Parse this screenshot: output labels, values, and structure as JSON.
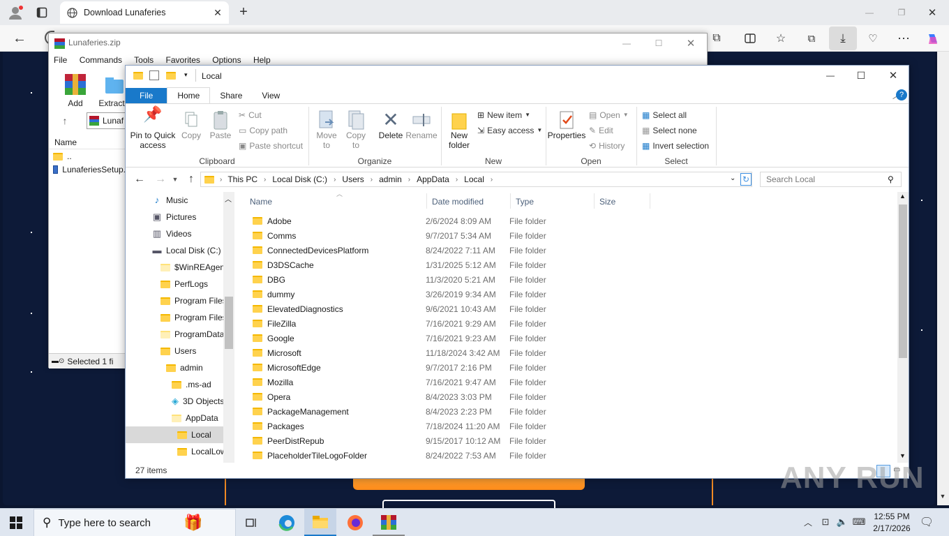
{
  "browser": {
    "tab_title": "Download Lunaferies",
    "new_tab_icon": "plus-icon"
  },
  "winrar": {
    "title": "Lunaferies.zip",
    "menu": [
      "File",
      "Commands",
      "Tools",
      "Favorites",
      "Options",
      "Help"
    ],
    "toolbar": {
      "add": "Add",
      "extract": "Extract"
    },
    "path": "Lunaf",
    "name_header": "Name",
    "files": [
      "..",
      "LunaferiesSetup."
    ],
    "status": "Selected 1 fi"
  },
  "explorer": {
    "title": "Local",
    "ribbon_tabs": [
      "File",
      "Home",
      "Share",
      "View"
    ],
    "clipboard": {
      "pin": "Pin to Quick access",
      "copy": "Copy",
      "paste": "Paste",
      "cut": "Cut",
      "copy_path": "Copy path",
      "paste_shortcut": "Paste shortcut",
      "label": "Clipboard"
    },
    "organize": {
      "move_to": "Move to",
      "copy_to": "Copy to",
      "delete": "Delete",
      "rename": "Rename",
      "label": "Organize"
    },
    "new": {
      "new_folder": "New folder",
      "new_item": "New item",
      "easy_access": "Easy access",
      "label": "New"
    },
    "open": {
      "properties": "Properties",
      "open": "Open",
      "edit": "Edit",
      "history": "History",
      "label": "Open"
    },
    "select": {
      "select_all": "Select all",
      "select_none": "Select none",
      "invert": "Invert selection",
      "label": "Select"
    },
    "breadcrumb": [
      "This PC",
      "Local Disk (C:)",
      "Users",
      "admin",
      "AppData",
      "Local"
    ],
    "search_placeholder": "Search Local",
    "tree": [
      {
        "label": "Music",
        "icon": "music-icon"
      },
      {
        "label": "Pictures",
        "icon": "pictures-icon"
      },
      {
        "label": "Videos",
        "icon": "videos-icon"
      },
      {
        "label": "Local Disk (C:)",
        "icon": "drive-icon"
      },
      {
        "label": "$WinREAgent",
        "icon": "folder-icon"
      },
      {
        "label": "PerfLogs",
        "icon": "folder-icon"
      },
      {
        "label": "Program Files",
        "icon": "folder-icon"
      },
      {
        "label": "Program Files",
        "icon": "folder-icon"
      },
      {
        "label": "ProgramData",
        "icon": "folder-icon"
      },
      {
        "label": "Users",
        "icon": "folder-icon"
      },
      {
        "label": "admin",
        "icon": "folder-icon"
      },
      {
        "label": ".ms-ad",
        "icon": "folder-icon"
      },
      {
        "label": "3D Objects",
        "icon": "3d-objects-icon"
      },
      {
        "label": "AppData",
        "icon": "folder-icon"
      },
      {
        "label": "Local",
        "icon": "folder-icon"
      },
      {
        "label": "LocalLow",
        "icon": "folder-icon"
      }
    ],
    "columns": [
      "Name",
      "Date modified",
      "Type",
      "Size"
    ],
    "rows": [
      {
        "name": "Adobe",
        "date": "2/6/2024 8:09 AM",
        "type": "File folder"
      },
      {
        "name": "Comms",
        "date": "9/7/2017 5:34 AM",
        "type": "File folder"
      },
      {
        "name": "ConnectedDevicesPlatform",
        "date": "8/24/2022 7:11 AM",
        "type": "File folder"
      },
      {
        "name": "D3DSCache",
        "date": "1/31/2025 5:12 AM",
        "type": "File folder"
      },
      {
        "name": "DBG",
        "date": "11/3/2020 5:21 AM",
        "type": "File folder"
      },
      {
        "name": "dummy",
        "date": "3/26/2019 9:34 AM",
        "type": "File folder"
      },
      {
        "name": "ElevatedDiagnostics",
        "date": "9/6/2021 10:43 AM",
        "type": "File folder"
      },
      {
        "name": "FileZilla",
        "date": "7/16/2021 9:29 AM",
        "type": "File folder"
      },
      {
        "name": "Google",
        "date": "7/16/2021 9:23 AM",
        "type": "File folder"
      },
      {
        "name": "Microsoft",
        "date": "11/18/2024 3:42 AM",
        "type": "File folder"
      },
      {
        "name": "MicrosoftEdge",
        "date": "9/7/2017 2:16 PM",
        "type": "File folder"
      },
      {
        "name": "Mozilla",
        "date": "7/16/2021 9:47 AM",
        "type": "File folder"
      },
      {
        "name": "Opera",
        "date": "8/4/2023 3:03 PM",
        "type": "File folder"
      },
      {
        "name": "PackageManagement",
        "date": "8/4/2023 2:23 PM",
        "type": "File folder"
      },
      {
        "name": "Packages",
        "date": "7/18/2024 11:20 AM",
        "type": "File folder"
      },
      {
        "name": "PeerDistRepub",
        "date": "9/15/2017 10:12 AM",
        "type": "File folder"
      },
      {
        "name": "PlaceholderTileLogoFolder",
        "date": "8/24/2022 7:53 AM",
        "type": "File folder"
      }
    ],
    "status": "27 items"
  },
  "taskbar": {
    "search_placeholder": "Type here to search",
    "time": "12:55 PM",
    "date": "2/17/2026"
  },
  "watermark": "ANY RUN"
}
